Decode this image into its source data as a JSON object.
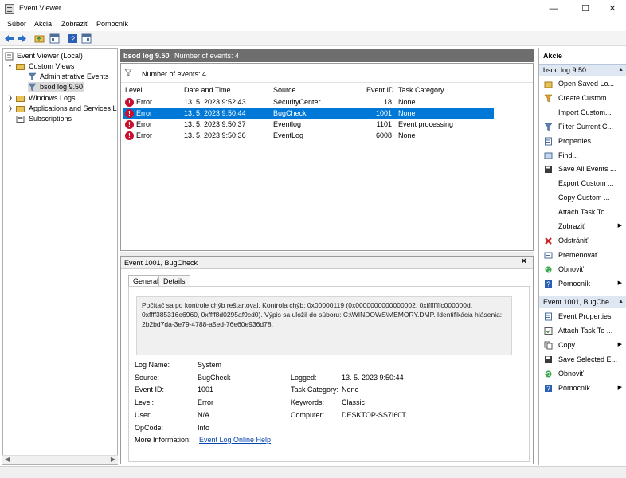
{
  "window": {
    "title": "Event Viewer"
  },
  "menu": [
    "Súbor",
    "Akcia",
    "Zobraziť",
    "Pomocník"
  ],
  "tree": {
    "root": "Event Viewer (Local)",
    "custom_views": "Custom Views",
    "admin_events": "Administrative Events",
    "bsod": "bsod log 9.50",
    "windows_logs": "Windows Logs",
    "apps_services": "Applications and Services Lo",
    "subscriptions": "Subscriptions"
  },
  "middle": {
    "header_title": "bsod log 9.50",
    "header_count": "Number of events: 4",
    "filter_count": "Number of events: 4",
    "columns": [
      "Level",
      "Date and Time",
      "Source",
      "Event ID",
      "Task Category"
    ],
    "rows": [
      {
        "level": "Error",
        "date": "13. 5. 2023 9:52:43",
        "source": "SecurityCenter",
        "id": "18",
        "task": "None",
        "selected": false
      },
      {
        "level": "Error",
        "date": "13. 5. 2023 9:50:44",
        "source": "BugCheck",
        "id": "1001",
        "task": "None",
        "selected": true
      },
      {
        "level": "Error",
        "date": "13. 5. 2023 9:50:37",
        "source": "Eventlog",
        "id": "1101",
        "task": "Event processing",
        "selected": false
      },
      {
        "level": "Error",
        "date": "13. 5. 2023 9:50:36",
        "source": "EventLog",
        "id": "6008",
        "task": "None",
        "selected": false
      }
    ]
  },
  "detail": {
    "title": "Event 1001, BugCheck",
    "close": "×",
    "tabs": [
      "General",
      "Details"
    ],
    "description": "Počítač sa po kontrole chýb reštartoval. Kontrola chýb: 0x00000119 (0x0000000000000002, 0xffffffffc000000d, 0xffff385316e6960, 0xffff8d0295af9cd0). Výpis sa uložil do súboru: C:\\WINDOWS\\MEMORY.DMP. Identifikácia hlásenia: 2b2bd7da-3e79-4788-a5ed-76e60e936d78.",
    "log_name_label": "Log Name:",
    "log_name": "System",
    "source_label": "Source:",
    "source": "BugCheck",
    "logged_label": "Logged:",
    "logged": "13. 5. 2023 9:50:44",
    "event_id_label": "Event ID:",
    "event_id": "1001",
    "task_label": "Task Category:",
    "task": "None",
    "level_label": "Level:",
    "level": "Error",
    "keywords_label": "Keywords:",
    "keywords": "Classic",
    "user_label": "User:",
    "user": "N/A",
    "computer_label": "Computer:",
    "computer": "DESKTOP-SS7I60T",
    "opcode_label": "OpCode:",
    "opcode": "Info",
    "more_label": "More Information:",
    "more_link": "Event Log Online Help"
  },
  "actions": {
    "heading": "Akcie",
    "section1": "bsod log 9.50",
    "items1": [
      "Open Saved Lo...",
      "Create Custom ...",
      "Import Custom...",
      "Filter Current C...",
      "Properties",
      "Find...",
      "Save All Events ...",
      "Export Custom ...",
      "Copy Custom ...",
      "Attach Task To ...",
      "Zobraziť",
      "Odstrániť",
      "Premenovať",
      "Obnoviť",
      "Pomocník"
    ],
    "section2": "Event 1001, BugChe...",
    "items2": [
      "Event Properties",
      "Attach Task To ...",
      "Copy",
      "Save Selected E...",
      "Obnoviť",
      "Pomocník"
    ]
  }
}
